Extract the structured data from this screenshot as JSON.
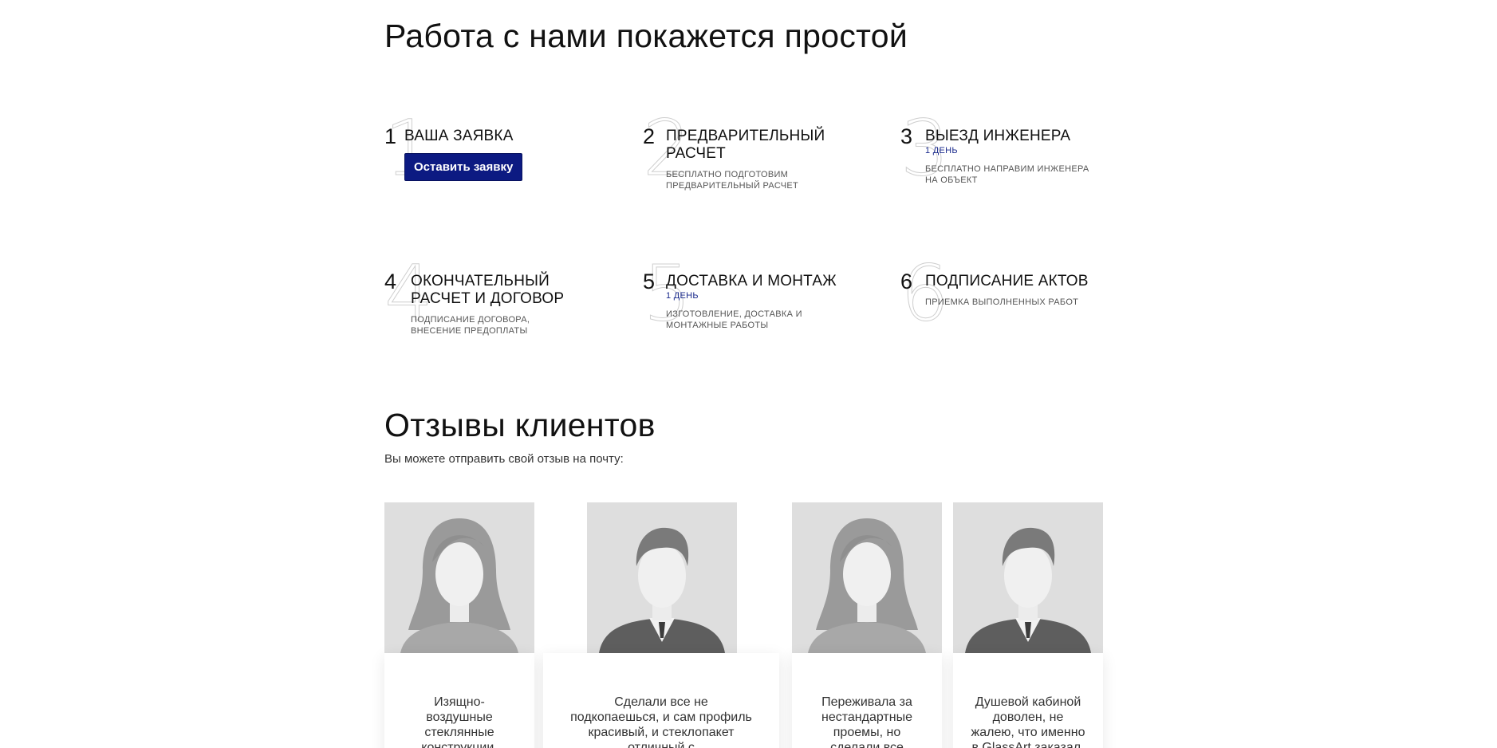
{
  "steps_section": {
    "heading": "Работа с нами покажется простой",
    "steps": [
      {
        "number": "1",
        "title": "ВАША ЗАЯВКА",
        "button": "Оставить заявку"
      },
      {
        "number": "2",
        "title": "ПРЕДВАРИТЕЛЬНЫЙ РАСЧЕТ",
        "title_line1": "ПРЕДВАРИТЕЛЬНЫЙ",
        "title_line2": "РАСЧЕТ",
        "desc_line1": "БЕСПЛАТНО ПОДГОТОВИМ",
        "desc_line2": "ПРЕДВАРИТЕЛЬНЫЙ РАСЧЕТ"
      },
      {
        "number": "3",
        "title": "ВЫЕЗД ИНЖЕНЕРА",
        "duration": "1 ДЕНЬ",
        "desc_line1": "БЕСПЛАТНО НАПРАВИМ ИНЖЕНЕРА",
        "desc_line2": "НА ОБЪЕКТ"
      },
      {
        "number": "4",
        "title_line1": "ОКОНЧАТЕЛЬНЫЙ",
        "title_line2": "РАСЧЕТ И ДОГОВОР",
        "desc_line1": "ПОДПИСАНИЕ ДОГОВОРА,",
        "desc_line2": "ВНЕСЕНИЕ ПРЕДОПЛАТЫ"
      },
      {
        "number": "5",
        "title": "ДОСТАВКА И МОНТАЖ",
        "duration": "1 ДЕНЬ",
        "desc_line1": "ИЗГОТОВЛЕНИЕ, ДОСТАВКА И",
        "desc_line2": "МОНТАЖНЫЕ РАБОТЫ"
      },
      {
        "number": "6",
        "title": "ПОДПИСАНИЕ АКТОВ",
        "desc_line1": "ПРИЕМКА ВЫПОЛНЕННЫХ РАБОТ"
      }
    ]
  },
  "reviews_section": {
    "heading": "Отзывы клиентов",
    "subtitle": "Вы можете отправить свой отзыв на почту:",
    "reviews": [
      {
        "avatar": "female-avatar-placeholder",
        "lines": [
          "Изящно-",
          "воздушные",
          "стеклянные",
          "конструкции."
        ]
      },
      {
        "avatar": "male-avatar-placeholder",
        "lines": [
          "Сделали все не",
          "подкопаешься, и сам профиль",
          "красивый, и стеклопакет",
          "отличный с"
        ]
      },
      {
        "avatar": "female-avatar-placeholder",
        "lines": [
          "Переживала за",
          "нестандартные",
          "проемы, но",
          "сделали все"
        ]
      },
      {
        "avatar": "male-avatar-placeholder",
        "lines": [
          "Душевой кабиной",
          "доволен, не",
          "жалею, что именно",
          "в GlassArt заказал."
        ]
      }
    ]
  },
  "colors": {
    "accent": "#0c1a82",
    "duration_text": "#1a2a8c",
    "avatar_bg": "#dedede"
  }
}
